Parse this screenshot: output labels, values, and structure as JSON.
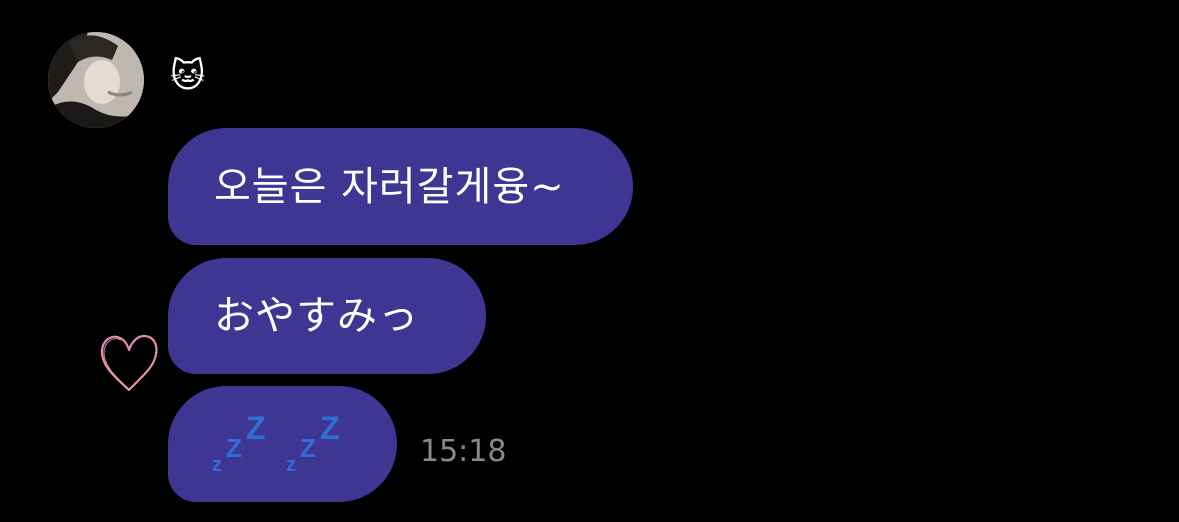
{
  "message_group": {
    "sender_label": "🐱",
    "messages": [
      {
        "text": "오늘은 자러갈게융~"
      },
      {
        "text": "おやすみっ"
      },
      {
        "text": "💤💤"
      }
    ],
    "timestamp": "15:18",
    "reaction": "heart-icon"
  },
  "colors": {
    "background": "#000000",
    "bubble": "#3f3592",
    "bubble_text": "#ffffff",
    "timestamp": "#8a8a8e",
    "heart": "#e88ab8",
    "zzz": "#2f6fd6"
  }
}
